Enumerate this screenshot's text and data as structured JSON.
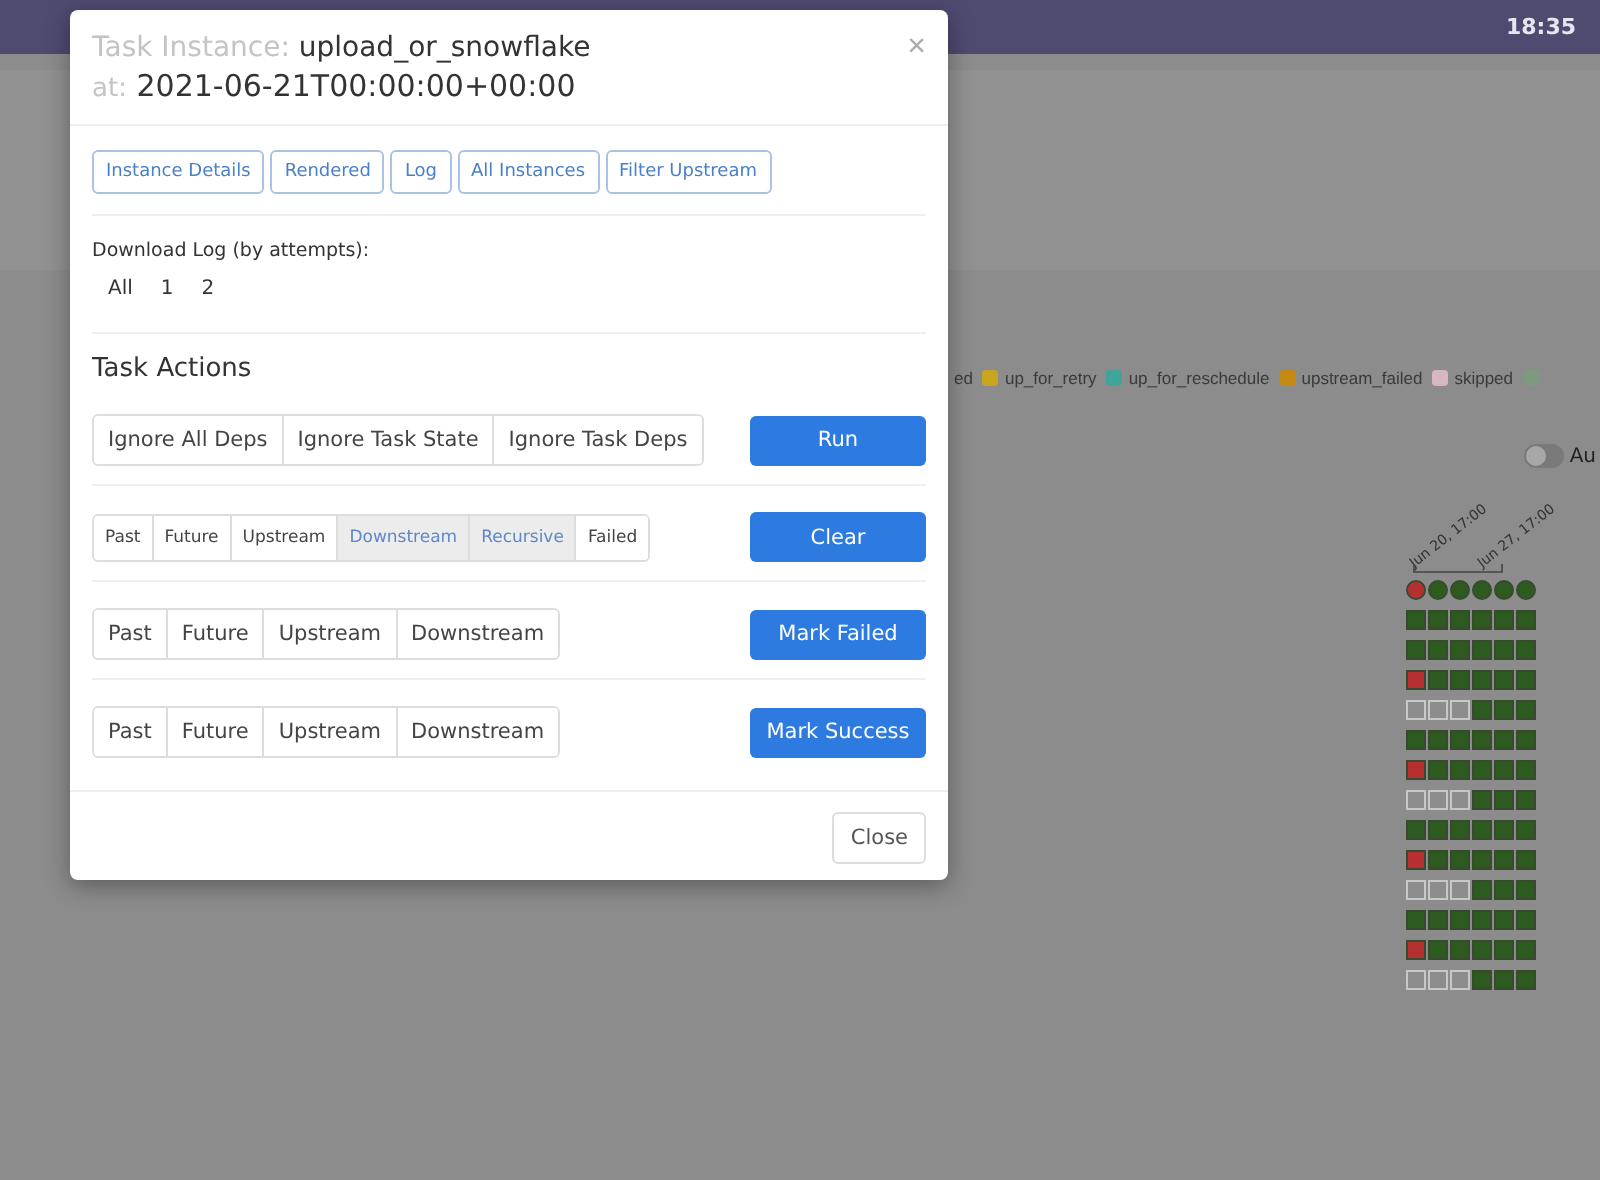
{
  "header": {
    "clock": "18:35"
  },
  "legend": [
    {
      "label": "ed"
    },
    {
      "label": "up_for_retry",
      "color": "#c9a51e"
    },
    {
      "label": "up_for_reschedule",
      "color": "#3fa59a"
    },
    {
      "label": "upstream_failed",
      "color": "#c48a12"
    },
    {
      "label": "skipped",
      "color": "#d8b8c0"
    },
    {
      "color": "#7e9a7e"
    }
  ],
  "auto_refresh": {
    "label": "Au",
    "on": false
  },
  "grid": {
    "date_labels": [
      "Jun 20, 17:00",
      "Jun 27, 17:00"
    ],
    "runs": [
      {
        "kind": "failed"
      },
      {
        "kind": "success"
      },
      {
        "kind": "success"
      },
      {
        "kind": "success"
      },
      {
        "kind": "success"
      },
      {
        "kind": "success"
      }
    ],
    "rows": [
      [
        {
          "kind": "success"
        },
        {
          "kind": "success"
        },
        {
          "kind": "success"
        },
        {
          "kind": "success"
        },
        {
          "kind": "success"
        },
        {
          "kind": "success"
        }
      ],
      [
        {
          "kind": "success"
        },
        {
          "kind": "success"
        },
        {
          "kind": "success"
        },
        {
          "kind": "success"
        },
        {
          "kind": "success"
        },
        {
          "kind": "success"
        }
      ],
      [
        {
          "kind": "failed"
        },
        {
          "kind": "success"
        },
        {
          "kind": "success"
        },
        {
          "kind": "success"
        },
        {
          "kind": "success"
        },
        {
          "kind": "success"
        }
      ],
      [
        {
          "kind": "none"
        },
        {
          "kind": "none"
        },
        {
          "kind": "none"
        },
        {
          "kind": "success"
        },
        {
          "kind": "success"
        },
        {
          "kind": "success"
        }
      ],
      [
        {
          "kind": "success"
        },
        {
          "kind": "success"
        },
        {
          "kind": "success"
        },
        {
          "kind": "success"
        },
        {
          "kind": "success"
        },
        {
          "kind": "success"
        }
      ],
      [
        {
          "kind": "failed"
        },
        {
          "kind": "success"
        },
        {
          "kind": "success"
        },
        {
          "kind": "success"
        },
        {
          "kind": "success"
        },
        {
          "kind": "success"
        }
      ],
      [
        {
          "kind": "none"
        },
        {
          "kind": "none"
        },
        {
          "kind": "none"
        },
        {
          "kind": "success"
        },
        {
          "kind": "success"
        },
        {
          "kind": "success"
        }
      ],
      [
        {
          "kind": "success"
        },
        {
          "kind": "success"
        },
        {
          "kind": "success"
        },
        {
          "kind": "success"
        },
        {
          "kind": "success"
        },
        {
          "kind": "success"
        }
      ],
      [
        {
          "kind": "failed"
        },
        {
          "kind": "success"
        },
        {
          "kind": "success"
        },
        {
          "kind": "success"
        },
        {
          "kind": "success"
        },
        {
          "kind": "success"
        }
      ],
      [
        {
          "kind": "none"
        },
        {
          "kind": "none"
        },
        {
          "kind": "none"
        },
        {
          "kind": "success"
        },
        {
          "kind": "success"
        },
        {
          "kind": "success"
        }
      ],
      [
        {
          "kind": "success"
        },
        {
          "kind": "success"
        },
        {
          "kind": "success"
        },
        {
          "kind": "success"
        },
        {
          "kind": "success"
        },
        {
          "kind": "success"
        }
      ],
      [
        {
          "kind": "failed"
        },
        {
          "kind": "success"
        },
        {
          "kind": "success"
        },
        {
          "kind": "success"
        },
        {
          "kind": "success"
        },
        {
          "kind": "success"
        }
      ],
      [
        {
          "kind": "none"
        },
        {
          "kind": "none"
        },
        {
          "kind": "none"
        },
        {
          "kind": "success"
        },
        {
          "kind": "success"
        },
        {
          "kind": "success"
        }
      ]
    ]
  },
  "dialog": {
    "title_label": "Task Instance:",
    "task_id": "upload_or_snowflake",
    "at_label": "at:",
    "execution_date": "2021-06-21T00:00:00+00:00",
    "close_icon": "×",
    "tabs": [
      "Instance Details",
      "Rendered",
      "Log",
      "All Instances",
      "Filter Upstream"
    ],
    "download_log": {
      "label": "Download Log (by attempts):",
      "links": [
        "All",
        "1",
        "2"
      ]
    },
    "actions_title": "Task Actions",
    "actions": [
      {
        "options": [
          {
            "label": "Ignore All Deps",
            "selected": false
          },
          {
            "label": "Ignore Task State",
            "selected": false
          },
          {
            "label": "Ignore Task Deps",
            "selected": false
          }
        ],
        "button": "Run",
        "kind": "regular"
      },
      {
        "options": [
          {
            "label": "Past",
            "selected": false
          },
          {
            "label": "Future",
            "selected": false
          },
          {
            "label": "Upstream",
            "selected": false
          },
          {
            "label": "Downstream",
            "selected": true
          },
          {
            "label": "Recursive",
            "selected": true
          },
          {
            "label": "Failed",
            "selected": false
          }
        ],
        "button": "Clear",
        "kind": "compact"
      },
      {
        "options": [
          {
            "label": "Past",
            "selected": false
          },
          {
            "label": "Future",
            "selected": false
          },
          {
            "label": "Upstream",
            "selected": false
          },
          {
            "label": "Downstream",
            "selected": false
          }
        ],
        "button": "Mark Failed",
        "kind": "regular"
      },
      {
        "options": [
          {
            "label": "Past",
            "selected": false
          },
          {
            "label": "Future",
            "selected": false
          },
          {
            "label": "Upstream",
            "selected": false
          },
          {
            "label": "Downstream",
            "selected": false
          }
        ],
        "button": "Mark Success",
        "kind": "regular"
      }
    ],
    "footer_button": "Close"
  }
}
